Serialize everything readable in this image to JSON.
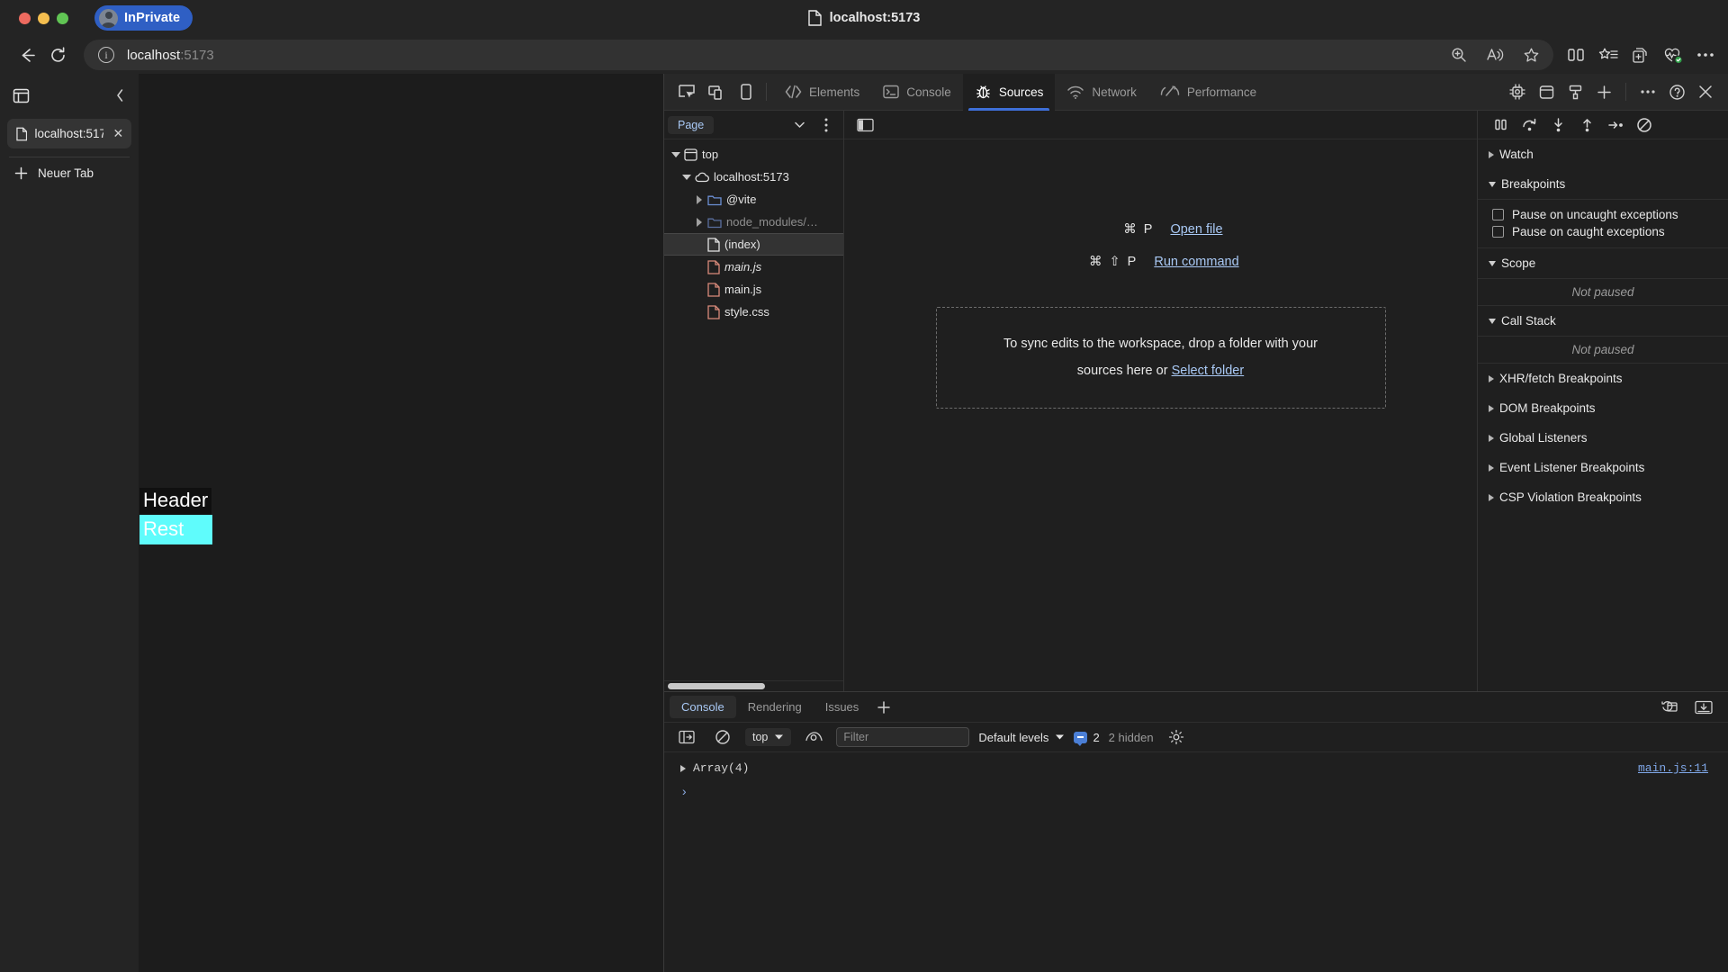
{
  "browser": {
    "profile_label": "InPrivate",
    "window_title": "localhost:5173",
    "address": {
      "host": "localhost",
      "port": ":5173"
    },
    "toolbar_icons": [
      "zoom-icon",
      "read-aloud-icon",
      "favorite-star-icon",
      "split-screen-icon",
      "collections-star-icon",
      "add-collection-icon",
      "browser-essentials-icon",
      "settings-more-icon"
    ],
    "nav_icons": [
      "back-arrow-icon",
      "reload-icon",
      "site-info-icon"
    ]
  },
  "tabstrip": {
    "collapse_label": "‹",
    "tabs": [
      {
        "title": "localhost:517",
        "close": "✕"
      }
    ],
    "new_tab_label": "Neuer Tab"
  },
  "page": {
    "header_text": "Header",
    "rest_text": "Rest",
    "rest_bg": "#5ffcfc",
    "header_bg": "#101010"
  },
  "devtools": {
    "device_icons": [
      "inspect-element-icon",
      "device-toolbar-icon",
      "device-frame-icon"
    ],
    "tabs": [
      {
        "label": "Elements",
        "icon": "code-brackets-icon",
        "active": false
      },
      {
        "label": "Console",
        "icon": "console-terminal-icon",
        "active": false
      },
      {
        "label": "Sources",
        "icon": "bug-icon",
        "active": true
      },
      {
        "label": "Network",
        "icon": "network-wifi-icon",
        "active": false
      },
      {
        "label": "Performance",
        "icon": "performance-gauge-icon",
        "active": false
      }
    ],
    "right_icons": [
      "memory-chip-icon",
      "application-storage-icon",
      "recorder-paintbrush-icon",
      "add-panel-plus-icon",
      "more-options-icon",
      "help-question-icon",
      "close-devtools-icon"
    ],
    "accent_color": "#3e6fd8"
  },
  "navigator": {
    "dropdown_label": "Page",
    "chevron_icon": "chevron-down-icon",
    "more_icon": "more-vertical-icon",
    "tree": [
      {
        "label": "top",
        "icon": "frame-icon",
        "indent": 0,
        "twisty": "down",
        "state": "normal"
      },
      {
        "label": "localhost:5173",
        "icon": "cloud-icon",
        "indent": 1,
        "twisty": "down",
        "state": "normal"
      },
      {
        "label": "@vite",
        "icon": "folder-blue-icon",
        "indent": 2,
        "twisty": "right",
        "state": "normal"
      },
      {
        "label": "node_modules/…",
        "icon": "folder-blue-icon",
        "indent": 2,
        "twisty": "right",
        "state": "dim"
      },
      {
        "label": "(index)",
        "icon": "document-white-icon",
        "indent": 3,
        "twisty": "none",
        "state": "selected"
      },
      {
        "label": "main.js",
        "icon": "document-red-icon",
        "indent": 3,
        "twisty": "none",
        "state": "italic"
      },
      {
        "label": "main.js",
        "icon": "document-red-icon",
        "indent": 3,
        "twisty": "none",
        "state": "normal"
      },
      {
        "label": "style.css",
        "icon": "document-red-icon",
        "indent": 3,
        "twisty": "none",
        "state": "normal"
      }
    ]
  },
  "editor": {
    "sidebar_toggle_icon": "show-navigator-icon",
    "shortcuts": [
      {
        "keys": "⌘ P",
        "label": "Open file"
      },
      {
        "keys": "⌘ ⇧ P",
        "label": "Run command"
      }
    ],
    "dropzone": {
      "line1": "To sync edits to the workspace, drop a folder with your",
      "line2_prefix": "sources here or ",
      "link": "Select folder"
    }
  },
  "debugger": {
    "controls": [
      "pause-resume-icon",
      "step-over-icon",
      "step-into-icon",
      "step-out-icon",
      "step-icon",
      "deactivate-breakpoints-icon"
    ],
    "sections": [
      {
        "label": "Watch",
        "expanded": false
      },
      {
        "label": "Breakpoints",
        "expanded": true
      },
      {
        "label": "Scope",
        "expanded": true
      },
      {
        "label": "Call Stack",
        "expanded": true
      },
      {
        "label": "XHR/fetch Breakpoints",
        "expanded": false
      },
      {
        "label": "DOM Breakpoints",
        "expanded": false
      },
      {
        "label": "Global Listeners",
        "expanded": false
      },
      {
        "label": "Event Listener Breakpoints",
        "expanded": false
      },
      {
        "label": "CSP Violation Breakpoints",
        "expanded": false
      }
    ],
    "checkboxes": [
      {
        "label": "Pause on uncaught exceptions",
        "checked": false
      },
      {
        "label": "Pause on caught exceptions",
        "checked": false
      }
    ],
    "scope_empty": "Not paused",
    "callstack_empty": "Not paused"
  },
  "drawer": {
    "tabs": [
      {
        "label": "Console",
        "active": true
      },
      {
        "label": "Rendering",
        "active": false
      },
      {
        "label": "Issues",
        "active": false
      }
    ],
    "add_tab_icon": "plus-icon",
    "right_icons": [
      "console-settings-history-icon",
      "dock-drawer-icon"
    ],
    "toolbar": {
      "sidebar_icon": "console-sidebar-icon",
      "clear_icon": "clear-console-icon",
      "context": "top",
      "context_chevron": "chevron-down-icon",
      "eye_icon": "live-expression-icon",
      "filter_placeholder": "Filter",
      "filter_value": "",
      "levels_label": "Default levels",
      "levels_chevron": "chevron-down-icon",
      "message_count": "2",
      "hidden_count": "2 hidden",
      "settings_icon": "gear-icon"
    },
    "log": [
      {
        "expand_icon": "triangle-right-icon",
        "text": "Array(4)",
        "source": "main.js:11"
      }
    ],
    "prompt_symbol": "›"
  }
}
